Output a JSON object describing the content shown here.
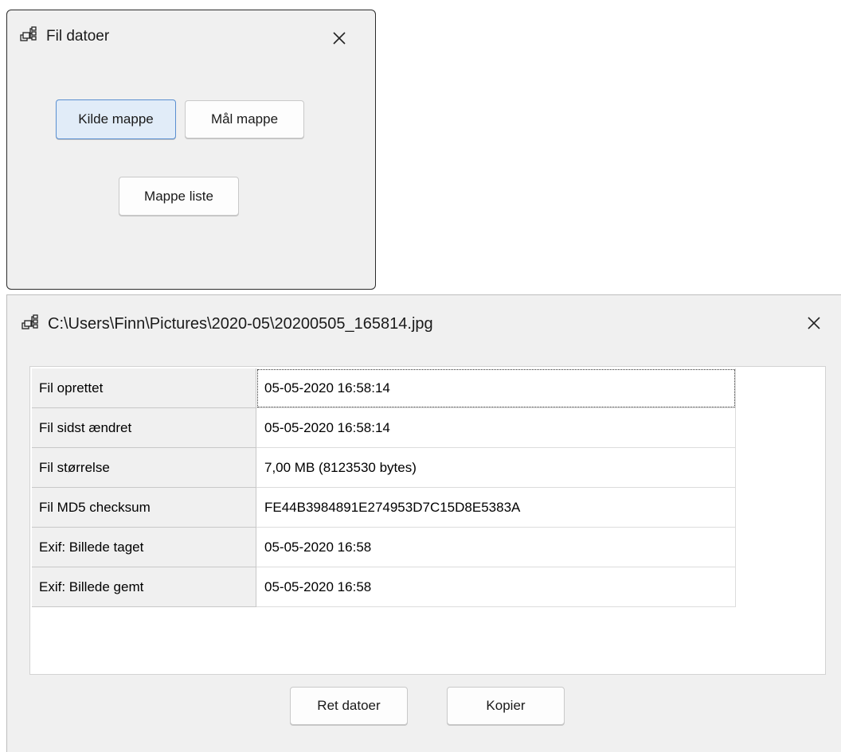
{
  "window1": {
    "title": "Fil datoer",
    "buttons": {
      "source_folder": "Kilde mappe",
      "target_folder": "Mål mappe",
      "folder_list": "Mappe liste"
    }
  },
  "window2": {
    "title": "C:\\Users\\Finn\\Pictures\\2020-05\\20200505_165814.jpg",
    "rows": [
      {
        "label": "Fil oprettet",
        "value": "05-05-2020 16:58:14"
      },
      {
        "label": "Fil sidst ændret",
        "value": "05-05-2020 16:58:14"
      },
      {
        "label": "Fil størrelse",
        "value": "7,00 MB (8123530 bytes)"
      },
      {
        "label": "Fil MD5 checksum",
        "value": "FE44B3984891E274953D7C15D8E5383A"
      },
      {
        "label": "Exif: Billede taget",
        "value": "05-05-2020 16:58"
      },
      {
        "label": "Exif: Billede gemt",
        "value": "05-05-2020 16:58"
      }
    ],
    "buttons": {
      "fix_dates": "Ret datoer",
      "copy": "Kopier"
    }
  },
  "icons": {
    "app": "network-tree-icon",
    "close": "close-icon"
  },
  "colors": {
    "window_bg": "#f0f0f0",
    "primary_button_bg": "#e1ecf8",
    "primary_button_border": "#5a8fd0"
  }
}
